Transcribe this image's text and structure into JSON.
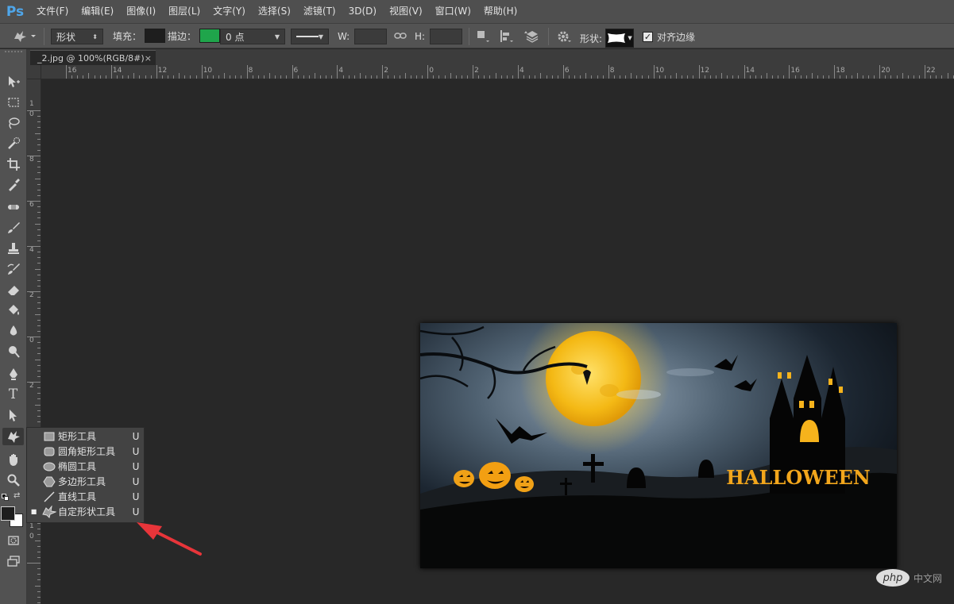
{
  "app": {
    "logo": "Ps"
  },
  "menu": [
    "文件(F)",
    "编辑(E)",
    "图像(I)",
    "图层(L)",
    "文字(Y)",
    "选择(S)",
    "滤镜(T)",
    "3D(D)",
    "视图(V)",
    "窗口(W)",
    "帮助(H)"
  ],
  "options": {
    "mode_select": "形状",
    "fill_label": "填充：",
    "fill_color": "#1e1e1e",
    "stroke_label": "描边：",
    "stroke_color": "#1fa54b",
    "stroke_width": "0 点",
    "w_label": "W:",
    "h_label": "H:",
    "shape_label": "形状:",
    "align_edges_label": "对齐边缘",
    "align_edges_checked": true
  },
  "document": {
    "tab_title": "_2.jpg @ 100%(RGB/8#)",
    "close_glyph": "×"
  },
  "rulers": {
    "horizontal": [
      "16",
      "14",
      "12",
      "10",
      "8",
      "6",
      "4",
      "2",
      "0",
      "2",
      "4",
      "6",
      "8",
      "10",
      "12",
      "14",
      "16",
      "18",
      "20",
      "22"
    ],
    "vertical": [
      "1",
      "0",
      "8",
      "6",
      "4",
      "2",
      "0",
      "2",
      "4",
      "6",
      "8",
      "1",
      "0"
    ]
  },
  "tools": [
    "move",
    "marquee",
    "lasso",
    "quick-select",
    "crop",
    "eyedropper",
    "spot-heal",
    "brush",
    "clone-stamp",
    "history-brush",
    "eraser",
    "paint-bucket",
    "blur",
    "dodge",
    "pen",
    "type",
    "path-select",
    "custom-shape",
    "hand",
    "zoom"
  ],
  "flyout": [
    {
      "label": "矩形工具",
      "key": "U",
      "icon": "rectangle-icon",
      "active": false
    },
    {
      "label": "圆角矩形工具",
      "key": "U",
      "icon": "rounded-rectangle-icon",
      "active": false
    },
    {
      "label": "椭圆工具",
      "key": "U",
      "icon": "ellipse-icon",
      "active": false
    },
    {
      "label": "多边形工具",
      "key": "U",
      "icon": "polygon-icon",
      "active": false
    },
    {
      "label": "直线工具",
      "key": "U",
      "icon": "line-icon",
      "active": false
    },
    {
      "label": "自定形状工具",
      "key": "U",
      "icon": "custom-shape-icon",
      "active": true
    }
  ],
  "artwork": {
    "halloween_text": "HALLOWEEN"
  },
  "watermark": {
    "badge": "php",
    "text": "中文网"
  },
  "colors": {
    "foreground": "#1e1e1e",
    "background": "#ffffff",
    "accent_arrow": "#e8353a"
  }
}
